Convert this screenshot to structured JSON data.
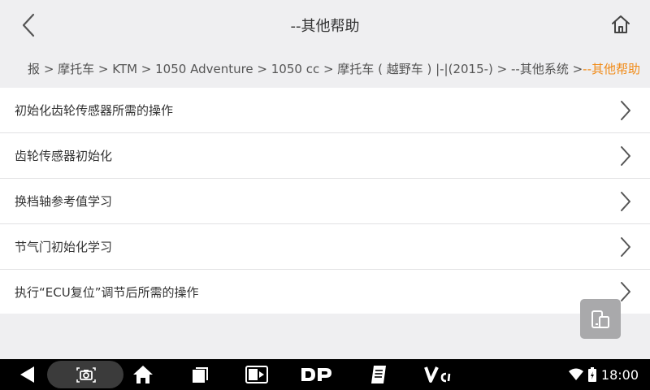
{
  "header": {
    "title": "--其他帮助"
  },
  "breadcrumb": {
    "path": "报 > 摩托车 > KTM > 1050 Adventure > 1050 cc > 摩托车 ( 越野车 ) |-|(2015-) > --其他系统 > ",
    "current": "--其他帮助"
  },
  "menu": {
    "items": [
      {
        "label": "初始化齿轮传感器所需的操作"
      },
      {
        "label": "齿轮传感器初始化"
      },
      {
        "label": "换档轴参考值学习"
      },
      {
        "label": "节气门初始化学习"
      },
      {
        "label": "执行“ECU复位”调节后所需的操作"
      }
    ]
  },
  "status_bar": {
    "time": "18:00"
  },
  "colors": {
    "accent": "#f08a16",
    "background": "#efeff1",
    "list_background": "#ffffff",
    "navbar": "#000000"
  },
  "icons": {
    "back": "chevron-left-icon",
    "home": "home-icon",
    "item_arrow": "chevron-right-icon",
    "float": "screen-switch-icon",
    "nav": [
      "back-triangle-icon",
      "screenshot-icon",
      "home-icon",
      "recent-apps-icon",
      "vci-display-icon",
      "dp-icon",
      "manual-icon",
      "vci-icon",
      "wifi-icon",
      "battery-icon"
    ]
  }
}
